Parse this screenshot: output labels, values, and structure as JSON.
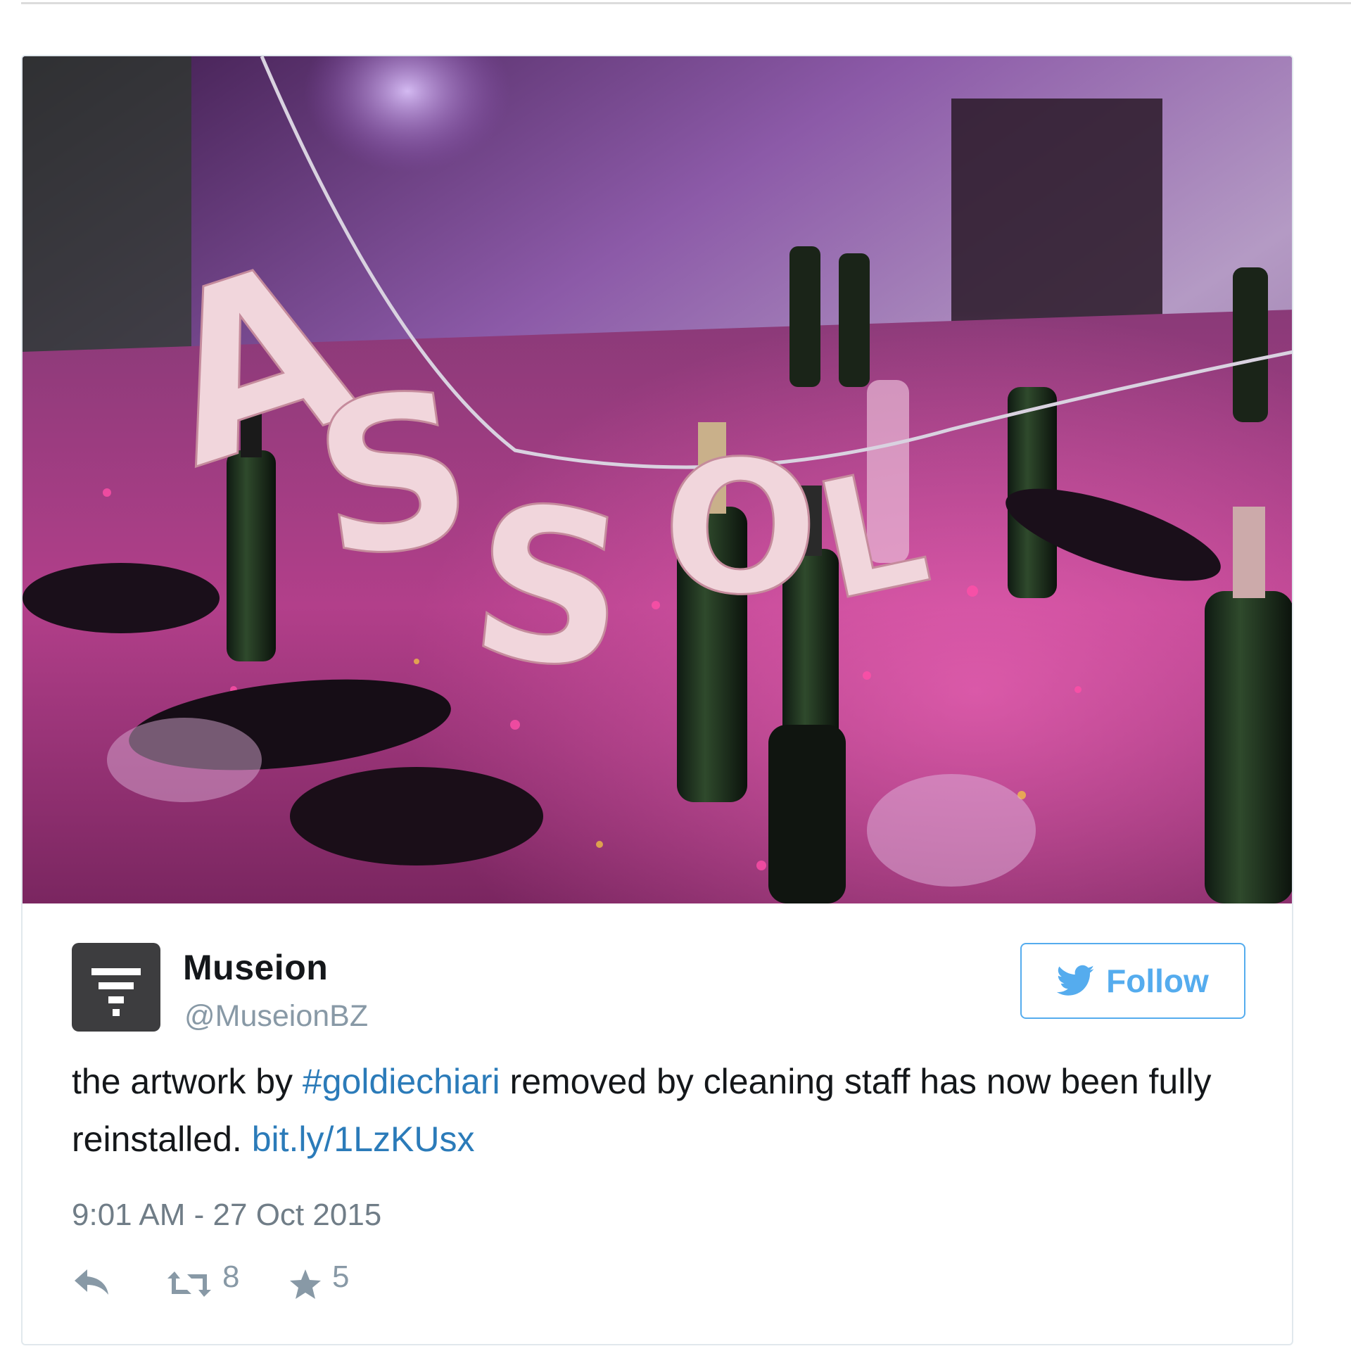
{
  "tweet": {
    "author": {
      "display_name": "Museion",
      "handle": "@MuseionBZ"
    },
    "follow_label": "Follow",
    "text": {
      "part1": "the artwork by ",
      "hashtag": "#goldiechiari",
      "part2": " removed by cleaning staff has now been fully reinstalled. ",
      "link": "bit.ly/1LzKUsx"
    },
    "timestamp": "9:01 AM - 27 Oct 2015",
    "actions": {
      "retweet_count": "8",
      "favorite_count": "5"
    },
    "media": {
      "banner_letters": [
        "A",
        "S",
        "S",
        "O",
        "L"
      ]
    }
  },
  "colors": {
    "link": "#2b7bb9",
    "follow_accent": "#55acee",
    "muted": "#8899a6",
    "border": "#e1e8ed"
  },
  "icons": {
    "avatar": "museion-logo-icon",
    "follow": "twitter-bird-icon",
    "reply": "reply-icon",
    "retweet": "retweet-icon",
    "favorite": "star-icon"
  }
}
